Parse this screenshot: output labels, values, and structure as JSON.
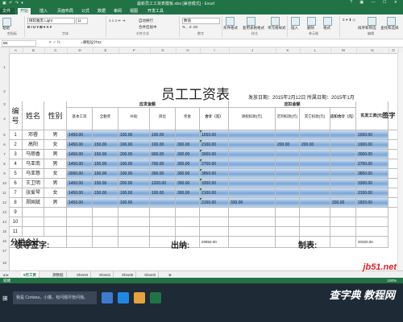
{
  "window": {
    "title": "最新员工工资表模板.xlsx [兼容模式] - Excel",
    "controls": "? ▣ — ☐ ✕"
  },
  "ribbon_tabs": [
    "文件",
    "开始",
    "插入",
    "页面布局",
    "公式",
    "数据",
    "审阅",
    "视图",
    "开发工具"
  ],
  "ribbon": {
    "font_name": "微软雅黑 Light",
    "font_size": "11",
    "number_format": "数值",
    "groups": [
      "剪贴板",
      "字体",
      "对齐方式",
      "数字",
      "样式",
      "单元格",
      "编辑"
    ],
    "buttons": [
      "粘贴",
      "自动换行",
      "合并后居中",
      "条件格式",
      "套用表格格式",
      "单元格样式",
      "插入",
      "删除",
      "格式",
      "排序和筛选",
      "查找和选择"
    ]
  },
  "formula_bar": {
    "name_box": "B5",
    "value": "=课程设计02"
  },
  "columns": [
    "A",
    "B",
    "C",
    "D",
    "E",
    "F",
    "G",
    "H",
    "I",
    "J",
    "K",
    "L",
    "M",
    "N",
    "O"
  ],
  "sheet": {
    "title": "员工工资表",
    "date_text": "发放日期：2015年2月12日 所属日期：2015年1月",
    "group_headers": {
      "pay": "应发金额",
      "deduct": "应扣金额"
    },
    "headers": {
      "no": "编号",
      "name": "姓名",
      "gender": "性别",
      "base": "基本工资",
      "full": "全勤奖",
      "subsidy": "补助",
      "post": "岗位",
      "bonus": "奖金",
      "total": "合计（元）",
      "leave": "请假扣款(元)",
      "late": "迟到扣款(元)",
      "other": "其它扣款(元)",
      "deduct_total": "应扣合计（元）",
      "actual": "实发工资(元)",
      "sign": "签字"
    },
    "rows": [
      {
        "no": "1",
        "name": "邓睿",
        "gender": "男",
        "base": "1450.00",
        "full": "",
        "subsidy": "100.00",
        "post": "100.00",
        "bonus": "",
        "total": "1650.00",
        "leave": "",
        "late": "",
        "other": "",
        "deduct_total": "",
        "actual": "1650.00"
      },
      {
        "no": "2",
        "name": "高阳",
        "gender": "女",
        "base": "1450.00",
        "full": "150.00",
        "subsidy": "100.00",
        "post": "100.00",
        "bonus": "300.00",
        "total": "2100.00",
        "leave": "",
        "late": "200.00",
        "other": "200.00",
        "deduct_total": "",
        "actual": "1900.00"
      },
      {
        "no": "3",
        "name": "马丽香",
        "gender": "男",
        "base": "1450.00",
        "full": "150.00",
        "subsidy": "200.00",
        "post": "900.00",
        "bonus": "300.00",
        "total": "3000.00",
        "leave": "",
        "late": "",
        "other": "",
        "deduct_total": "",
        "actual": "3000.00"
      },
      {
        "no": "4",
        "name": "马亚南",
        "gender": "男",
        "base": "1450.00",
        "full": "150.00",
        "subsidy": "100.00",
        "post": "700.00",
        "bonus": "300.00",
        "total": "2700.00",
        "leave": "",
        "late": "",
        "other": "",
        "deduct_total": "",
        "actual": "2700.00"
      },
      {
        "no": "5",
        "name": "马亚慈",
        "gender": "女",
        "base": "3000.00",
        "full": "150.00",
        "subsidy": "100.00",
        "post": "300.00",
        "bonus": "300.00",
        "total": "3850.00",
        "leave": "",
        "late": "",
        "other": "",
        "deduct_total": "",
        "actual": "3850.00"
      },
      {
        "no": "6",
        "name": "王卫明",
        "gender": "男",
        "base": "1450.00",
        "full": "150.00",
        "subsidy": "200.00",
        "post": "1200.00",
        "bonus": "300.00",
        "total": "3300.00",
        "leave": "",
        "late": "",
        "other": "",
        "deduct_total": "",
        "actual": "3300.00"
      },
      {
        "no": "7",
        "name": "张爱琴",
        "gender": "女",
        "base": "1450.00",
        "full": "150.00",
        "subsidy": "100.00",
        "post": "100.00",
        "bonus": "300.00",
        "total": "2100.00",
        "leave": "",
        "late": "",
        "other": "",
        "deduct_total": "",
        "actual": "2100.00"
      },
      {
        "no": "8",
        "name": "郑国斌",
        "gender": "男",
        "base": "1450.00",
        "full": "",
        "subsidy": "100.00",
        "post": "",
        "bonus": "",
        "total": "2150.00",
        "leave": "330.00",
        "late": "",
        "other": "",
        "deduct_total": "330.00",
        "actual": "1820.00"
      }
    ],
    "empty_row_numbers": [
      "9",
      "10",
      "11"
    ],
    "subtotal_label": "分栏合计",
    "subtotal_total": "20850.00",
    "subtotal_actual": "20320.00",
    "footer": {
      "leader": "领导签字:",
      "cashier": "出纳:",
      "maker": "制表:"
    }
  },
  "row_numbers": [
    "1",
    "2",
    "3",
    "4",
    "5",
    "6",
    "7",
    "8",
    "9",
    "10",
    "11",
    "12",
    "13",
    "14",
    "15",
    "16",
    "17",
    "18",
    "19",
    "20"
  ],
  "sheet_tabs": [
    "5月工资",
    "源数据",
    "Sheet4",
    "Sheet1",
    "Sheet5",
    "Sheet2"
  ],
  "status": {
    "ready": "就绪",
    "zoom": "100%"
  },
  "taskbar": {
    "search_placeholder": "我是 Cortana，小娜。有问题尽管问我。"
  },
  "watermarks": {
    "site": "jb51.net",
    "brand": "查字典 教程网"
  }
}
